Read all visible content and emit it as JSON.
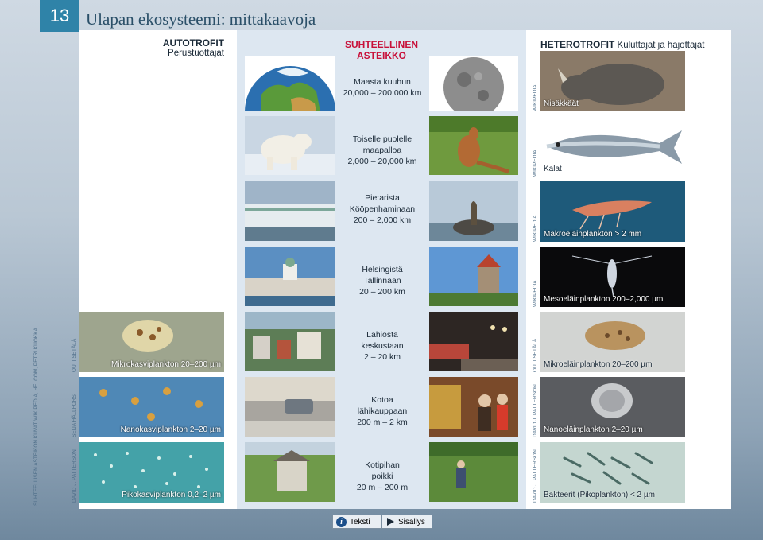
{
  "page": {
    "number": "13",
    "title": "Ulapan ekosysteemi: mittakaavoja"
  },
  "headers": {
    "left_bold": "AUTOTROFIT",
    "left_sub": "Perustuottajat",
    "mid_line1": "SUHTEELLINEN",
    "mid_line2": "ASTEIKKO",
    "right_bold": "HETEROTROFIT",
    "right_sub": "Kuluttajat ja hajottajat"
  },
  "scale_rows": [
    {
      "l1": "Maasta kuuhun",
      "l2": "",
      "range": "20,000 – 200,000 km"
    },
    {
      "l1": "Toiselle puolelle",
      "l2": "maapalloa",
      "range": "2,000 – 20,000 km"
    },
    {
      "l1": "Pietarista",
      "l2": "Kööpenhaminaan",
      "range": "200 – 2,000 km"
    },
    {
      "l1": "Helsingistä",
      "l2": "Tallinnaan",
      "range": "20 – 200 km"
    },
    {
      "l1": "Lähiöstä",
      "l2": "keskustaan",
      "range": "2 – 20 km"
    },
    {
      "l1": "Kotoa",
      "l2": "lähikauppaan",
      "range": "200 m – 2 km"
    },
    {
      "l1": "Kotipihan",
      "l2": "poikki",
      "range": "20 m – 200 m"
    }
  ],
  "heterotrophs": [
    {
      "label": "Nisäkkäät",
      "credit": "WIKIPEDIA"
    },
    {
      "label": "Kalat",
      "credit": "WIKIPEDIA"
    },
    {
      "label": "Makroeläinplankton > 2 mm",
      "credit": "WIKIPEDIA"
    },
    {
      "label": "Mesoeläinplankton 200–2,000 µm",
      "credit": "WIKIPEDIA"
    },
    {
      "label": "Mikroeläinplankton 20–200 µm",
      "credit": "OUTI SETÄLÄ"
    },
    {
      "label": "Nanoeläinplankton 2–20 µm",
      "credit": "DAVID J. PATTERSON"
    },
    {
      "label": "Bakteerit (Pikoplankton) < 2 µm",
      "credit": "DAVID J. PATTERSON"
    }
  ],
  "autotrophs": [
    {
      "label": "Mikrokasviplankton 20–200 µm",
      "credit": "OUTI SETÄLÄ"
    },
    {
      "label": "Nanokasviplankton 2–20 µm",
      "credit": "SEIJA HÄLLFORS"
    },
    {
      "label": "Pikokasviplankton 0,2–2 µm",
      "credit": "DAVID J. PATTERSON"
    }
  ],
  "side_credit": "SUHTEELLISEN ASTEIKON KUVAT WIKIPEDIA, HELCOM, PETRI KUOKKA",
  "buttons": {
    "text": "Teksti",
    "contents": "Sisällys"
  },
  "icons": {
    "info": "info-icon",
    "play": "play-icon"
  }
}
